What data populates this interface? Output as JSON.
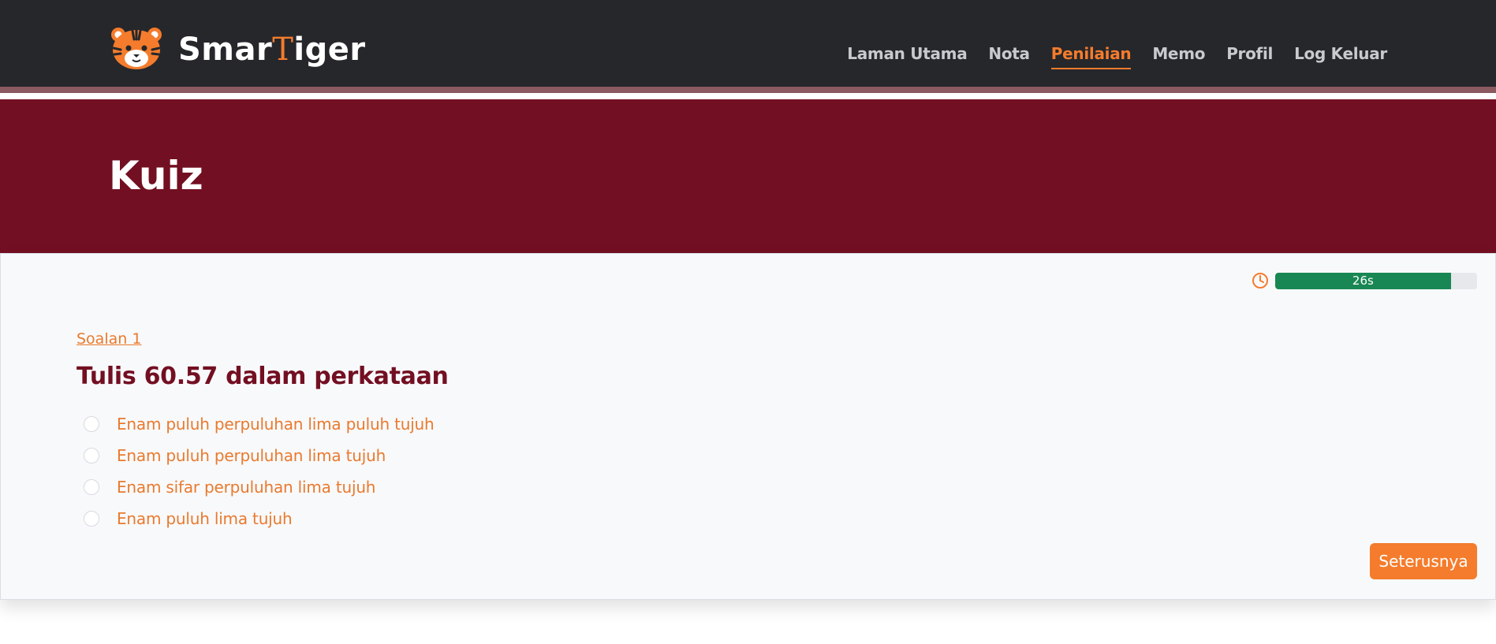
{
  "brand": {
    "name_prefix": "Smar",
    "name_accent": "T",
    "name_suffix": "iger",
    "logo_icon": "tiger-logo-icon"
  },
  "nav": {
    "items": [
      {
        "label": "Laman Utama",
        "active": false
      },
      {
        "label": "Nota",
        "active": false
      },
      {
        "label": "Penilaian",
        "active": true
      },
      {
        "label": "Memo",
        "active": false
      },
      {
        "label": "Profil",
        "active": false
      },
      {
        "label": "Log Keluar",
        "active": false
      }
    ]
  },
  "banner": {
    "title": "Kuiz"
  },
  "timer": {
    "icon": "clock-icon",
    "label": "26s",
    "progress_fraction": 0.87,
    "color": "#198754"
  },
  "question": {
    "label": "Soalan 1",
    "text": "Tulis 60.57 dalam perkataan",
    "options": [
      "Enam puluh perpuluhan lima puluh tujuh",
      "Enam puluh perpuluhan lima tujuh",
      "Enam sifar perpuluhan lima tujuh",
      "Enam puluh lima tujuh"
    ]
  },
  "actions": {
    "next_label": "Seterusnya"
  },
  "colors": {
    "accent": "#f47c2c",
    "banner": "#730f22",
    "navbar": "#26272b"
  }
}
